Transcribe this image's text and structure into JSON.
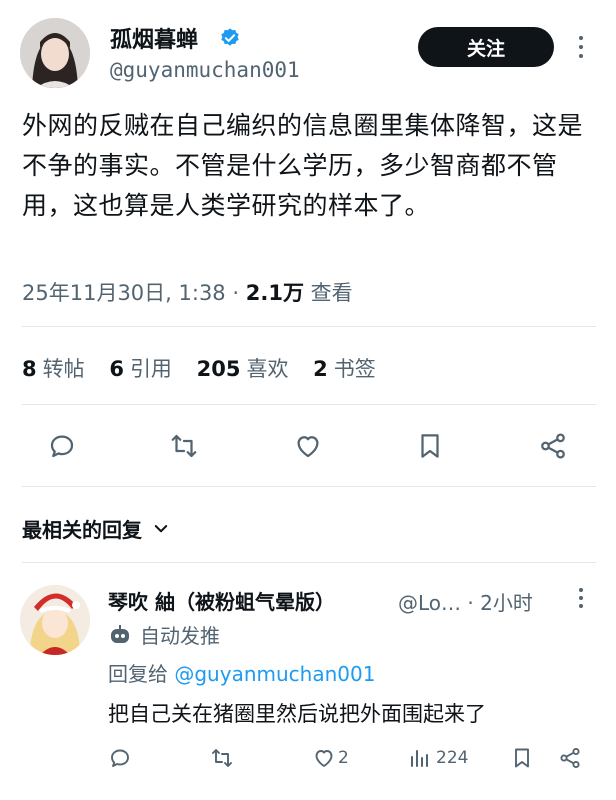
{
  "tweet": {
    "author_name": "孤烟暮蝉",
    "author_handle": "@guyanmuchan001",
    "follow_label": "关注",
    "text": "外网的反贼在自己编织的信息圈里集体降智，这是不争的事实。不管是什么学历，多少智商都不管用，这也算是人类学研究的样本了。",
    "timestamp": "25年11月30日, 1:38",
    "separator": "·",
    "views": "2.1万",
    "views_label": "查看"
  },
  "stats": [
    {
      "count": "8",
      "label": "转帖"
    },
    {
      "count": "6",
      "label": "引用"
    },
    {
      "count": "205",
      "label": "喜欢"
    },
    {
      "count": "2",
      "label": "书签"
    }
  ],
  "actions": [
    "reply-icon",
    "retweet-icon",
    "like-icon",
    "bookmark-icon",
    "share-icon"
  ],
  "replies_section": {
    "sort_label": "最相关的回复"
  },
  "reply": {
    "author_name": "琴吹 紬（被粉蛆气晕版）",
    "author_handle": "@Lo…",
    "time": "· 2小时",
    "automated_label": "自动发推",
    "replying_prefix": "回复给",
    "replying_to": "@guyanmuchan001",
    "text": "把自己关在猪圈里然后说把外面围起来了",
    "like_count": "2",
    "view_count": "224"
  },
  "colors": {
    "accent": "#1d9bf0",
    "text_primary": "#0f1419",
    "text_secondary": "#536471",
    "button_bg": "#0f1419",
    "divider": "#e4e6e8"
  }
}
